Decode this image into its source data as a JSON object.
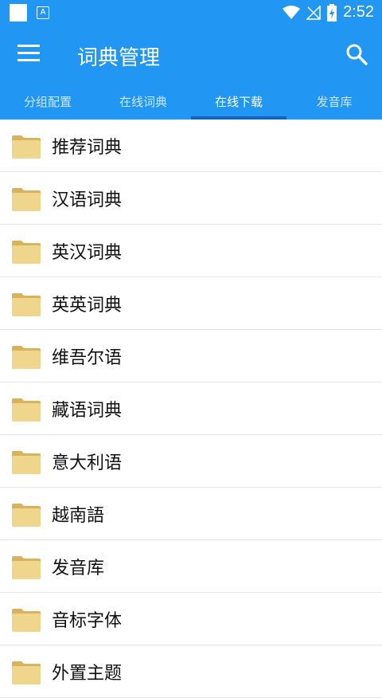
{
  "status": {
    "time": "2:52"
  },
  "header": {
    "title": "词典管理"
  },
  "tabs": [
    {
      "label": "分组配置"
    },
    {
      "label": "在线词典"
    },
    {
      "label": "在线下载"
    },
    {
      "label": "发音库"
    }
  ],
  "active_tab": "在线下载",
  "items": [
    {
      "label": "推荐词典"
    },
    {
      "label": "汉语词典"
    },
    {
      "label": "英汉词典"
    },
    {
      "label": "英英词典"
    },
    {
      "label": "维吾尔语"
    },
    {
      "label": "藏语词典"
    },
    {
      "label": "意大利语"
    },
    {
      "label": "越南語"
    },
    {
      "label": "发音库"
    },
    {
      "label": "音标字体"
    },
    {
      "label": "外置主题"
    }
  ],
  "icons": {
    "menu": "hamburger-menu-icon",
    "search": "search-icon",
    "folder": "folder-icon",
    "wifi": "wifi-icon",
    "no-signal": "no-signal-icon",
    "battery": "battery-charging-icon"
  },
  "colors": {
    "primary": "#2196F3",
    "indicator": "#1565C0",
    "folder": "#E8C878"
  }
}
